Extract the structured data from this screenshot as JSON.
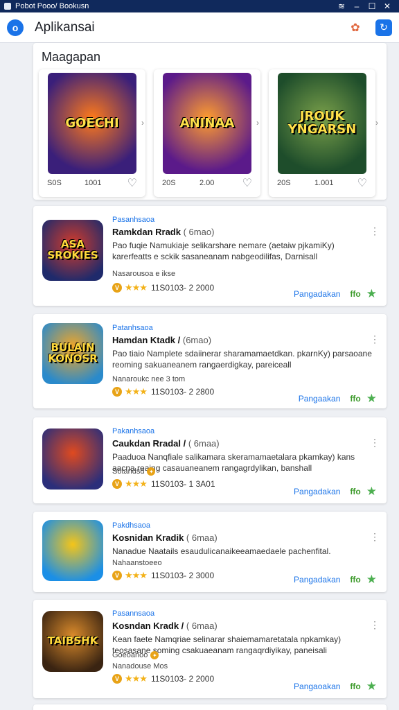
{
  "window": {
    "title": "Pobot Pooo/ Bookusn",
    "icons": [
      "app-window-icon",
      "wifi-icon",
      "minimize-icon",
      "maximize-icon",
      "close-icon"
    ]
  },
  "appbar": {
    "logo_letter": "o",
    "title": "Aplikansai",
    "accent": "#1a73e8",
    "cloud_glyph": "✿",
    "sync_glyph": "↻"
  },
  "featured": {
    "title": "Maagapan",
    "arrow_glyph": "›",
    "cards": [
      {
        "art_label": "GOECHI",
        "left_value": "S0S",
        "mid_value": "1001",
        "heart": "♡",
        "colors": [
          "#3a1f7a",
          "#ff7a1a"
        ]
      },
      {
        "art_label": "ANINAA",
        "left_value": "20S",
        "mid_value": "2.00",
        "heart": "♡",
        "colors": [
          "#5b1a8a",
          "#ff9d2e"
        ]
      },
      {
        "art_label": "JROUK\nYNGARSN",
        "left_value": "20S",
        "mid_value": "1.001",
        "heart": "♡",
        "colors": [
          "#1e4d2b",
          "#7aa04a"
        ]
      }
    ]
  },
  "apps": [
    {
      "icon_label": "ASA\nSROKIES",
      "icon_colors": [
        "#1f2a6b",
        "#d43b2a"
      ],
      "category": "Pasanhsaoa",
      "name": "Ramkdan Rradk",
      "size": "( 6mao)",
      "desc": "Pao fuqie Namukiaje selikarshare nemare (aetaiw pjkamiKy) karerfeatts e sckik sasaneanam nabgeodilifas, Darnisall",
      "extra": "Nasarousoa e ikse",
      "rating_text": "11S0103-  2 2000",
      "download_label": "Pangadakan",
      "price": "ffo"
    },
    {
      "icon_label": "BULAIN\nKONOSR",
      "icon_colors": [
        "#2a8acb",
        "#f5a623"
      ],
      "category": "Patanhsaoa",
      "name": "Hamdan Ktadk /",
      "size": "(6mao)",
      "desc": "Pao tiaio Namplete sdaiinerar sharamamaetdkan. pkarnKy) parsaoane  reoming sakuaneanem rangaerdigkay, pareiceall",
      "extra": "Nanaroukc nee 3 tom",
      "rating_text": "11S0103-  2 2800",
      "download_label": "Pangaakan",
      "price": "ffo"
    },
    {
      "icon_label": "",
      "icon_colors": [
        "#2b2e7a",
        "#e04a1f"
      ],
      "category": "Pakanhsaoa",
      "name": "Caukdan Rradal /",
      "size": "( 6maa)",
      "desc": "Paaduoa Nanqfiale salikamara skeramamaetalara pkamkay) kans aacna reaing casauaneanem rangagrdylikan, banshall",
      "extra": "Sotandsd",
      "rating_text": "11S0103-  1 3A01",
      "download_label": "Pangadakan",
      "price": "ffo"
    },
    {
      "icon_label": "",
      "icon_colors": [
        "#1b8fe6",
        "#f5c518"
      ],
      "category": "Pakdhsaoa",
      "name": "Kosnidan Kradik",
      "size": "( 6maa)",
      "desc": "Nanadue Naatails esaudulicanaikeeamaedaele pachenfital.",
      "extra": "Nahaanstoeeo",
      "rating_text": "11S0103-  2 3000",
      "download_label": "Pangadakan",
      "price": "ffo"
    },
    {
      "icon_label": "TAIBSHK",
      "icon_colors": [
        "#3a2412",
        "#d98a2b"
      ],
      "category": "Pasannsaoa",
      "name": "Kosndan Kradk /",
      "size": "( 6maa)",
      "desc": "Kean faete Namqriae selinarar shaiemamaretatala npkamkay) teosasane soming csakuaeanam rangaqrdiyikay, paneisali",
      "extra": "Goeoanoo",
      "extra2": "Nanadouse Mos",
      "rating_text": "11S0103-  2 2000",
      "download_label": "Pangaoakan",
      "price": "ffo"
    }
  ]
}
